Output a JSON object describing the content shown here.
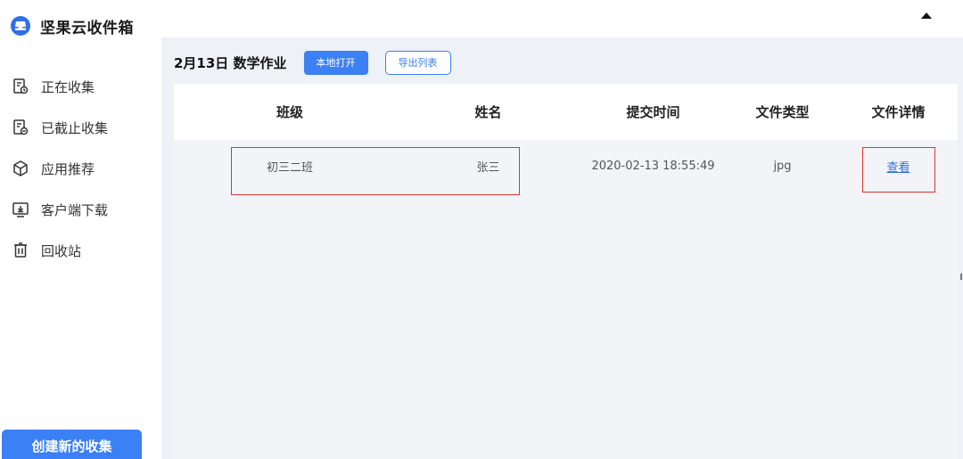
{
  "app": {
    "title": "坚果云收件箱"
  },
  "sidebar": {
    "items": [
      {
        "label": "正在收集",
        "icon": "collecting-icon"
      },
      {
        "label": "已截止收集",
        "icon": "closed-collection-icon"
      },
      {
        "label": "应用推荐",
        "icon": "box-icon"
      },
      {
        "label": "客户端下载",
        "icon": "download-client-icon"
      },
      {
        "label": "回收站",
        "icon": "trash-icon"
      }
    ],
    "create_label": "创建新的收集"
  },
  "main": {
    "title": "2月13日 数学作业",
    "open_local_label": "本地打开",
    "export_label": "导出列表"
  },
  "table": {
    "headers": [
      "班级",
      "姓名",
      "提交时间",
      "文件类型",
      "文件详情"
    ],
    "rows": [
      {
        "class": "初三二班",
        "name": "张三",
        "time": "2020-02-13 18:55:49",
        "type": "jpg",
        "detail": "查看"
      }
    ]
  },
  "colors": {
    "accent": "#3b80f4",
    "highlight": "#e0342f",
    "background": "#eef1f6"
  }
}
